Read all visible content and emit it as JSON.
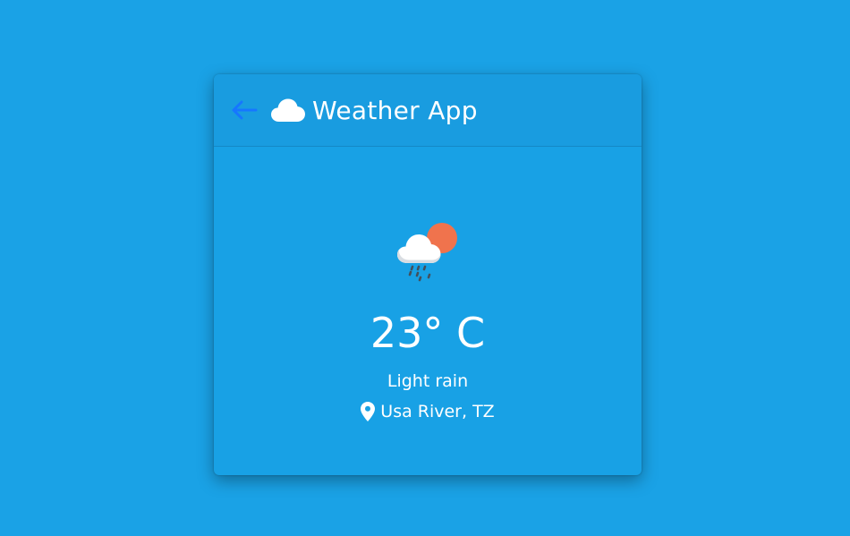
{
  "header": {
    "title": "Weather App",
    "back_icon": "arrow-left-icon",
    "title_icon": "cloud-icon"
  },
  "weather": {
    "icon": "rain-cloud-sun-icon",
    "temperature": "23° C",
    "description": "Light rain",
    "location": "Usa River, TZ",
    "location_icon": "map-pin-icon"
  },
  "colors": {
    "background": "#1aa2e6",
    "card": "#18a1e5",
    "header": "#199ce0",
    "back_arrow": "#1677ff",
    "sun": "#f0734d",
    "text": "#ffffff"
  }
}
